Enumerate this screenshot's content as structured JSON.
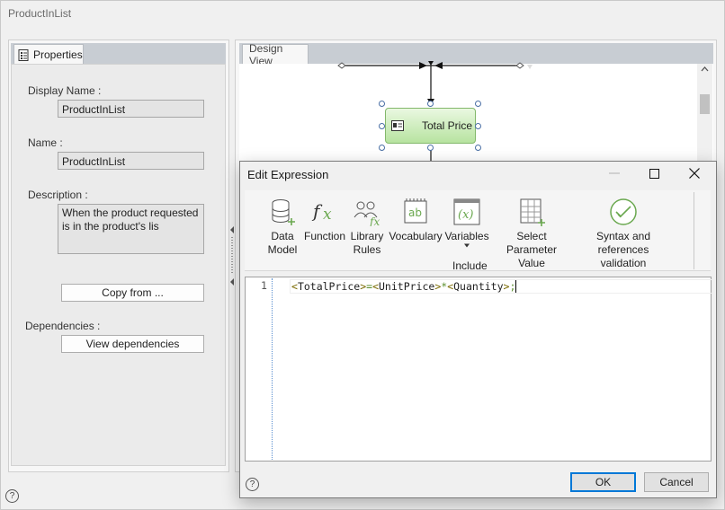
{
  "window": {
    "title": "ProductInList"
  },
  "properties_panel": {
    "tab_label": "Properties",
    "display_name": {
      "label": "Display Name :",
      "value": "ProductInList"
    },
    "name": {
      "label": "Name :",
      "value": "ProductInList"
    },
    "description": {
      "label": "Description :",
      "value": "When the product requested is in the product's lis"
    },
    "copy_from_label": "Copy from ...",
    "dependencies": {
      "label": "Dependencies :",
      "button_label": "View dependencies"
    }
  },
  "design_view": {
    "tab_label": "Design View",
    "node_label": "Total Price"
  },
  "dialog": {
    "title": "Edit Expression",
    "ribbon": {
      "items": [
        {
          "label_line1": "Data",
          "label_line2": "Model",
          "icon": "data-model-icon"
        },
        {
          "label_line1": "Function",
          "label_line2": "",
          "icon": "function-icon"
        },
        {
          "label_line1": "Library",
          "label_line2": "Rules",
          "icon": "library-rules-icon"
        },
        {
          "label_line1": "Vocabulary",
          "label_line2": "",
          "icon": "vocabulary-icon"
        },
        {
          "label_line1": "Variables",
          "label_line2": "",
          "icon": "variables-icon"
        },
        {
          "label_line1": "Select Parameter",
          "label_line2": "Value",
          "icon": "select-parameter-icon"
        },
        {
          "label_line1": "Syntax and references",
          "label_line2": "validation",
          "icon": "validation-icon"
        }
      ],
      "group_label": "Include"
    },
    "editor": {
      "line_number": "1",
      "tokens": [
        "<",
        "TotalPrice",
        ">",
        "=",
        "<",
        "UnitPrice",
        ">",
        "*",
        "<",
        "Quantity",
        ">",
        ";"
      ]
    },
    "ok_label": "OK",
    "cancel_label": "Cancel",
    "help_label": "?"
  },
  "main_help_label": "?",
  "colors": {
    "node_fill": "#b7e3a0",
    "accent": "#0078d7",
    "operator": "#5b8f2d"
  }
}
